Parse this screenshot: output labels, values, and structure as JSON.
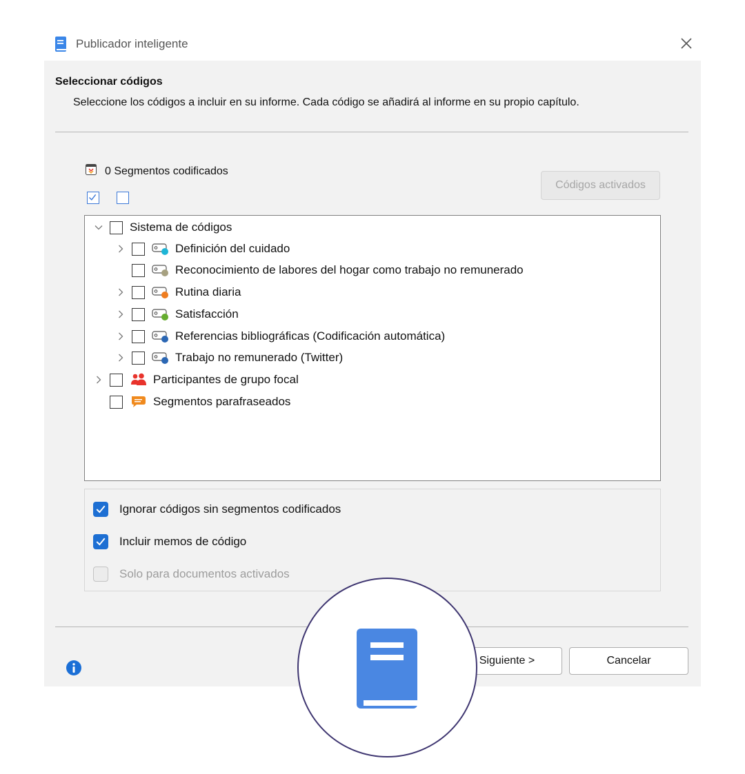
{
  "window": {
    "title": "Publicador inteligente"
  },
  "section": {
    "title": "Seleccionar códigos",
    "description": "Seleccione los códigos a incluir en su informe. Cada código se añadirá al informe en su propio capítulo."
  },
  "segments": {
    "count_label": "0 Segmentos codificados",
    "activated_button": "Códigos activados"
  },
  "tree": {
    "root": "Sistema de códigos",
    "codes": [
      {
        "label": "Definición del cuidado",
        "color": "#1fb5d6",
        "expandable": true
      },
      {
        "label": "Reconocimiento de labores del hogar como trabajo no remunerado",
        "color": "#a7a181",
        "expandable": false
      },
      {
        "label": "Rutina diaria",
        "color": "#ef7d20",
        "expandable": true
      },
      {
        "label": "Satisfacción",
        "color": "#66ad2f",
        "expandable": true
      },
      {
        "label": "Referencias bibliográficas (Codificación automática)",
        "color": "#2b67b4",
        "expandable": true
      },
      {
        "label": "Trabajo no remunerado (Twitter)",
        "color": "#2b67b4",
        "expandable": true
      }
    ],
    "focus_group": "Participantes de grupo focal",
    "paraphrased": "Segmentos parafraseados",
    "focus_icon_color": "#e8332c",
    "paraphrase_icon_color": "#f08a1e"
  },
  "options": {
    "ignore_empty": {
      "label": "Ignorar códigos sin segmentos codificados",
      "checked": true
    },
    "include_memos": {
      "label": "Incluir memos de código",
      "checked": true
    },
    "only_activated": {
      "label": "Solo para documentos activados",
      "checked": false,
      "disabled": true
    }
  },
  "buttons": {
    "next": "Siguiente >",
    "cancel": "Cancelar"
  },
  "colors": {
    "accent": "#1d6fd3",
    "book_icon": "#4a87e2",
    "overlay_border": "#3e3570"
  }
}
